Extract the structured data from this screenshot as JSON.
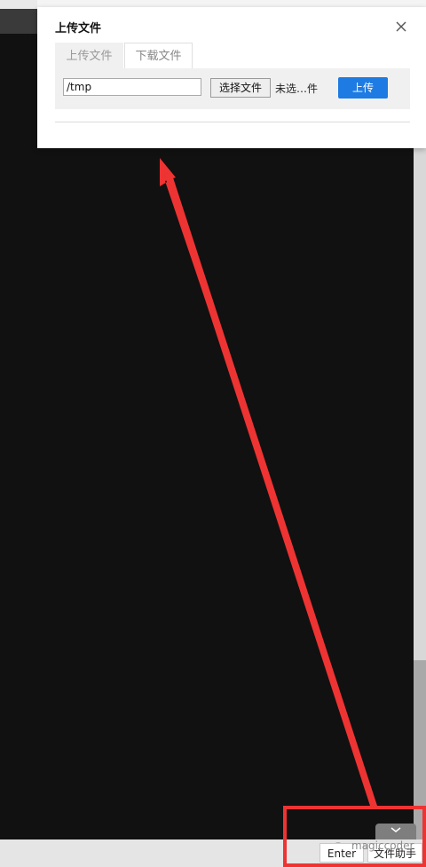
{
  "dialog": {
    "title": "上传文件",
    "close_icon": "close-icon",
    "tabs": [
      {
        "label": "上传文件",
        "active": true
      },
      {
        "label": "下载文件",
        "active": false
      }
    ],
    "path_value": "/tmp",
    "choose_label": "选择文件",
    "no_file_label": "未选…件",
    "upload_label": "上传"
  },
  "bottom": {
    "enter_label": "Enter",
    "helper_label": "文件助手",
    "collapse_icon": "chevron-down-icon"
  },
  "watermark": {
    "text": "magiccoder",
    "icon": "wechat-icon"
  },
  "colors": {
    "terminal_bg": "#111111",
    "primary_button": "#1e7be3",
    "annotation_red": "#ee3333"
  }
}
